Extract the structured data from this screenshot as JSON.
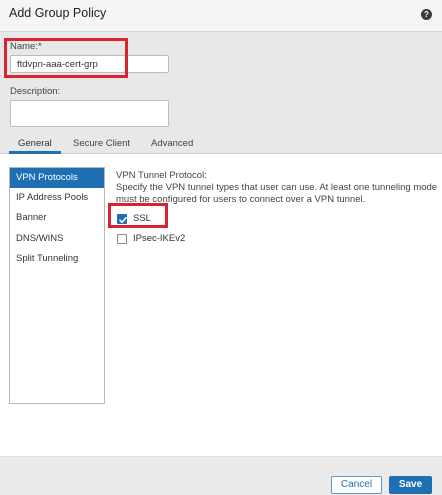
{
  "dialog": {
    "title": "Add Group Policy",
    "help_icon": "help-icon"
  },
  "form": {
    "name_label": "Name:*",
    "name_value": "ftdvpn-aaa-cert-grp",
    "description_label": "Description:",
    "description_value": ""
  },
  "tabs": [
    {
      "label": "General",
      "active": true
    },
    {
      "label": "Secure Client",
      "active": false
    },
    {
      "label": "Advanced",
      "active": false
    }
  ],
  "nav": [
    {
      "label": "VPN Protocols",
      "active": true
    },
    {
      "label": "IP Address Pools",
      "active": false
    },
    {
      "label": "Banner",
      "active": false
    },
    {
      "label": "DNS/WINS",
      "active": false
    },
    {
      "label": "Split Tunneling",
      "active": false
    }
  ],
  "vpn": {
    "section_title": "VPN Tunnel Protocol:",
    "description": "Specify the VPN tunnel types that user can use. At least one tunneling mode must be configured for users to connect over a VPN tunnel.",
    "protocols": [
      {
        "label": "SSL",
        "checked": true
      },
      {
        "label": "IPsec-IKEv2",
        "checked": false
      }
    ]
  },
  "buttons": {
    "cancel": "Cancel",
    "save": "Save"
  },
  "colors": {
    "accent": "#1f6fb5",
    "highlight": "#d9242f"
  }
}
